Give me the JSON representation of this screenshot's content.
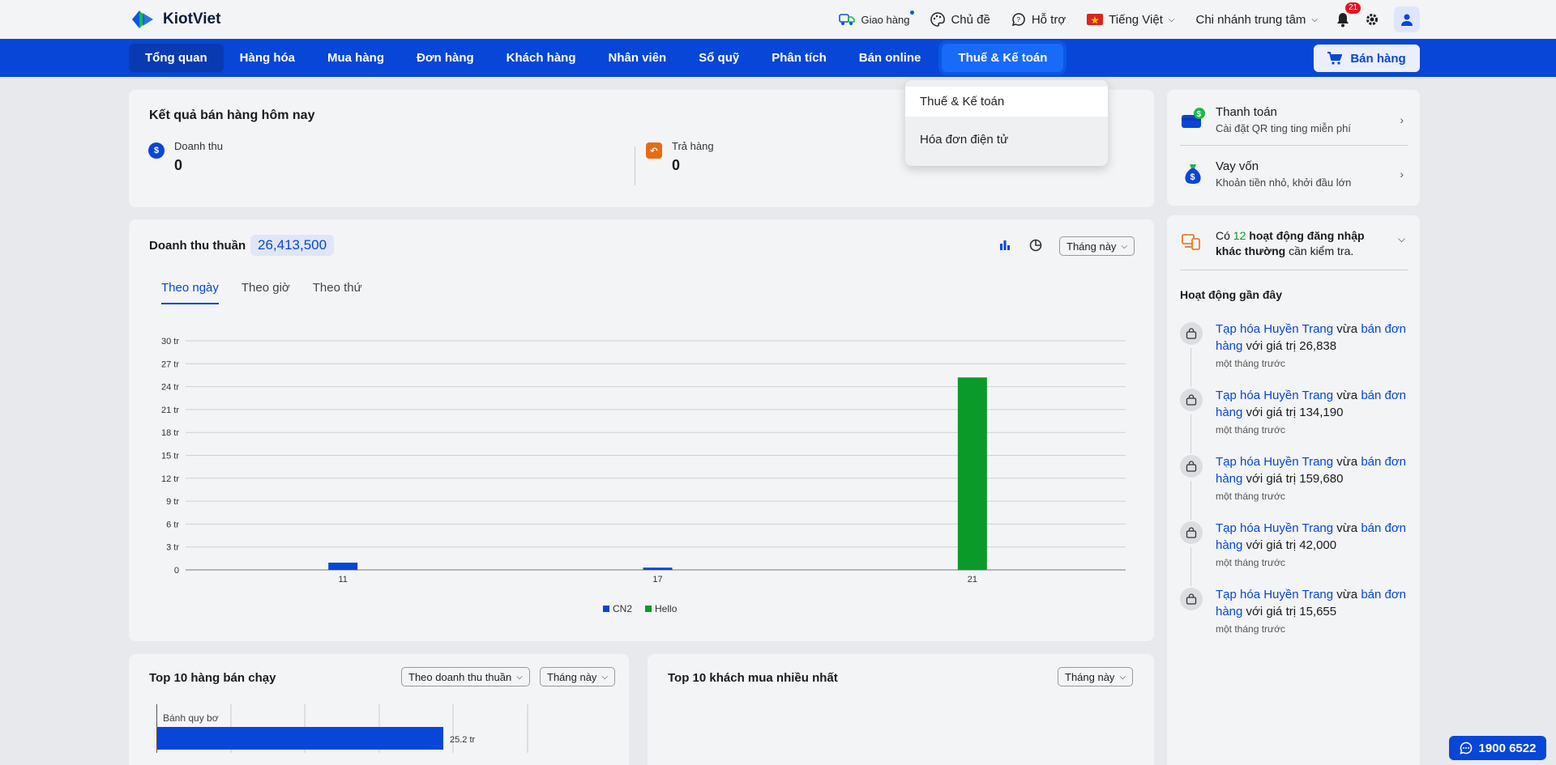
{
  "brand": {
    "name": "KiotViet"
  },
  "header": {
    "delivery": "Giao hàng",
    "theme": "Chủ đề",
    "support": "Hỗ trợ",
    "language": "Tiếng Việt",
    "branch": "Chi nhánh trung tâm",
    "notification_count": "21"
  },
  "nav": {
    "items": [
      {
        "label": "Tổng quan"
      },
      {
        "label": "Hàng hóa"
      },
      {
        "label": "Mua hàng"
      },
      {
        "label": "Đơn hàng"
      },
      {
        "label": "Khách hàng"
      },
      {
        "label": "Nhân viên"
      },
      {
        "label": "Sổ quỹ"
      },
      {
        "label": "Phân tích"
      },
      {
        "label": "Bán online"
      },
      {
        "label": "Thuế & Kế toán"
      }
    ],
    "sell_button": "Bán hàng"
  },
  "dropdown": {
    "items": [
      {
        "label": "Thuế & Kế toán"
      },
      {
        "label": "Hóa đơn điện tử"
      }
    ]
  },
  "today": {
    "title": "Kết quả bán hàng hôm nay",
    "revenue_label": "Doanh thu",
    "revenue_value": "0",
    "returns_label": "Trả hàng",
    "returns_value": "0"
  },
  "net_revenue": {
    "title": "Doanh thu thuần",
    "total": "26,413,500",
    "period": "Tháng này",
    "tabs": [
      "Theo ngày",
      "Theo giờ",
      "Theo thứ"
    ]
  },
  "chart_data": {
    "type": "bar",
    "categories": [
      "11",
      "17",
      "21"
    ],
    "series": [
      {
        "name": "CN2",
        "color": "#0746d6",
        "values": [
          0.95,
          0.3,
          0
        ]
      },
      {
        "name": "Hello",
        "color": "#0a9a2a",
        "values": [
          0,
          0,
          25.2
        ]
      }
    ],
    "y_ticks": [
      "0",
      "3 tr",
      "6 tr",
      "9 tr",
      "12 tr",
      "15 tr",
      "18 tr",
      "21 tr",
      "24 tr",
      "27 tr",
      "30 tr"
    ],
    "ylim": [
      0,
      30
    ],
    "y_unit": "tr",
    "grid": true,
    "legend": "bottom"
  },
  "top_products": {
    "title": "Top 10 hàng bán chạy",
    "sort": "Theo doanh thu thuần",
    "period": "Tháng này",
    "bar": {
      "label": "Bánh quy bơ",
      "value_label": "25.2 tr",
      "fraction_of_axis": 0.63
    }
  },
  "top_customers": {
    "title": "Top 10 khách mua nhiều nhất",
    "period": "Tháng này"
  },
  "sidebar": {
    "promos": [
      {
        "title": "Thanh toán",
        "subtitle": "Cài đặt QR ting ting miễn phí"
      },
      {
        "title": "Vay vốn",
        "subtitle": "Khoản tiền nhỏ, khởi đầu lớn"
      }
    ],
    "alert": {
      "prefix": "Có ",
      "count": "12",
      "bold": " hoạt động đăng nhập khác thường",
      "suffix": " cần kiểm tra."
    },
    "recent_title": "Hoạt động gần đây",
    "activities": [
      {
        "store": "Tạp hóa Huyền Trang",
        "verb": " vừa ",
        "action": "bán đơn hàng",
        "mid": " với giá trị ",
        "amount": "26,838",
        "time": "một tháng trước"
      },
      {
        "store": "Tạp hóa Huyền Trang",
        "verb": " vừa ",
        "action": "bán đơn hàng",
        "mid": " với giá trị ",
        "amount": "134,190",
        "time": "một tháng trước"
      },
      {
        "store": "Tạp hóa Huyền Trang",
        "verb": " vừa ",
        "action": "bán đơn hàng",
        "mid": " với giá trị ",
        "amount": "159,680",
        "time": "một tháng trước"
      },
      {
        "store": "Tạp hóa Huyền Trang",
        "verb": " vừa ",
        "action": "bán đơn hàng",
        "mid": " với giá trị ",
        "amount": "42,000",
        "time": "một tháng trước"
      },
      {
        "store": "Tạp hóa Huyền Trang",
        "verb": " vừa ",
        "action": "bán đơn hàng",
        "mid": " với giá trị ",
        "amount": "15,655",
        "time": "một tháng trước"
      }
    ]
  },
  "hotline": "1900 6522"
}
